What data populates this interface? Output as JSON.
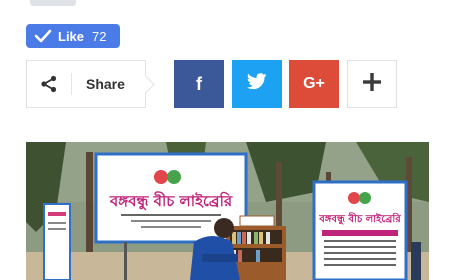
{
  "like": {
    "label": "Like",
    "count": "72",
    "icon": "check-icon"
  },
  "share": {
    "label": "Share",
    "icon": "share-icon"
  },
  "social": {
    "facebook": {
      "glyph": "f",
      "color": "#3b5998"
    },
    "twitter": {
      "icon": "twitter-bird-icon",
      "color": "#1da1f2"
    },
    "googleplus": {
      "glyph": "G+",
      "color": "#dd4b39"
    },
    "more": {
      "glyph": "+"
    }
  },
  "photo": {
    "banner_left": "বঙ্গবন্ধু বীচ লাইব্রেরি",
    "banner_right": "বঙ্গবন্ধু বীচ লাইব্রেরি"
  }
}
